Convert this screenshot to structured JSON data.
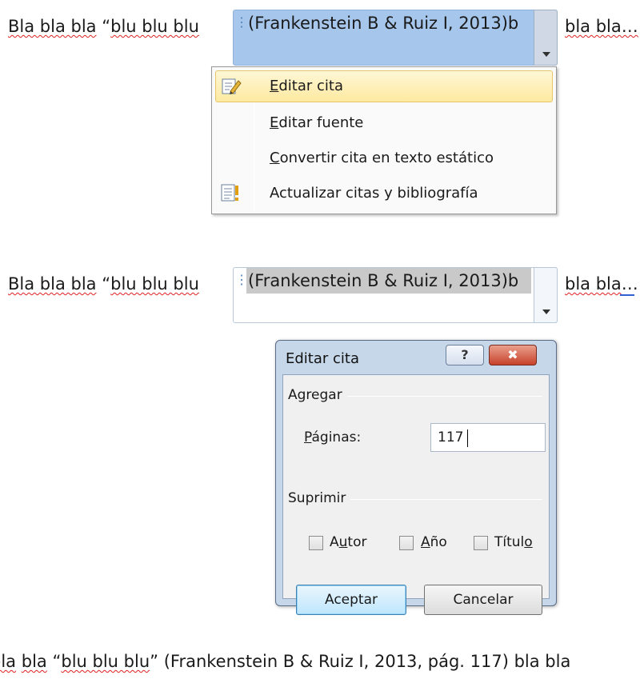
{
  "block1": {
    "pre_squig1": "Bla bla bla",
    "pre_quote": "“",
    "pre_squig2": "blu blu blu",
    "citation": "(Frankenstein B & Ruiz I, 2013)b",
    "post_text": "bla bla…"
  },
  "context_menu": {
    "items": [
      {
        "accel": "E",
        "rest": "ditar cita",
        "icon": "edit-citation-icon"
      },
      {
        "accel": "E",
        "rest": "ditar fuente",
        "icon": ""
      },
      {
        "accel": "C",
        "rest": "onvertir cita en texto estático",
        "icon": ""
      },
      {
        "accel": "",
        "rest": "Actualizar citas y bibliografía",
        "icon": "update-citations-icon"
      }
    ]
  },
  "block2": {
    "pre_squig1": "Bla bla bla",
    "pre_quote": "“",
    "pre_squig2": "blu blu blu",
    "citation": "(Frankenstein B & Ruiz I, 2013)b",
    "post_squig": "bla bla",
    "post_ellipsis": "…"
  },
  "dialog": {
    "title": "Editar cita",
    "help_label": "?",
    "close_label": "✖",
    "add_group": "Agregar",
    "pages_label_accel": "P",
    "pages_label_rest": "áginas:",
    "pages_value": "117",
    "suppress_group": "Suprimir",
    "checkboxes": [
      {
        "label_pre": "A",
        "label_accel": "u",
        "label_post": "tor",
        "checked": false
      },
      {
        "label_pre": "",
        "label_accel": "A",
        "label_post": "ño",
        "checked": false
      },
      {
        "label_pre": "Títul",
        "label_accel": "o",
        "label_post": "",
        "checked": false
      }
    ],
    "ok_label": "Aceptar",
    "cancel_label": "Cancelar"
  },
  "result_line": {
    "pre1": "bla",
    "pre2": "bla",
    "quote_open": "“",
    "quoted": "blu blu blu",
    "rest": "” (Frankenstein B & Ruiz I, 2013, pág. 117) bla bla"
  },
  "colors": {
    "control_active": "#a6c6ec",
    "menu_highlight": "#fde9a0",
    "spell_underline": "#e02020",
    "dialog_frame": "#c7d7ea",
    "close_button": "#c7412a"
  }
}
